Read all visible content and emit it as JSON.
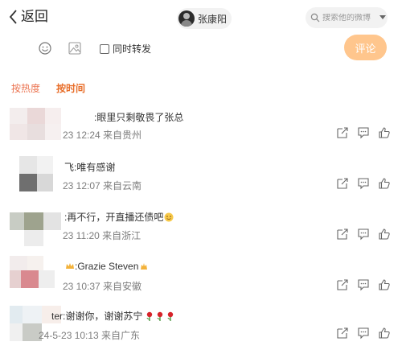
{
  "header": {
    "back_label": "返回",
    "user_name": "张康阳",
    "search_placeholder": "搜索他的微博"
  },
  "toolbar": {
    "repost_label": "同时转发",
    "comment_button": "评论"
  },
  "sort": {
    "hot_label": "按热度",
    "time_label": "按时间"
  },
  "comments": [
    {
      "text": ":眼里只剩敬畏了张总",
      "meta": "23 12:24 来自贵州"
    },
    {
      "text": "飞:唯有感谢",
      "meta": "23 12:07 来自云南"
    },
    {
      "text": ":再不行，开直播还债吧",
      "meta": "23 11:20 来自浙江"
    },
    {
      "text": ":Grazie Steven",
      "meta": "23 10:37 来自安徽"
    },
    {
      "text": "ter:谢谢你，谢谢苏宁",
      "meta": "24-5-23 10:13 来自广东"
    }
  ],
  "colors": {
    "accent": "#e86e2a",
    "comment_button_bg": "#ffc68d"
  }
}
